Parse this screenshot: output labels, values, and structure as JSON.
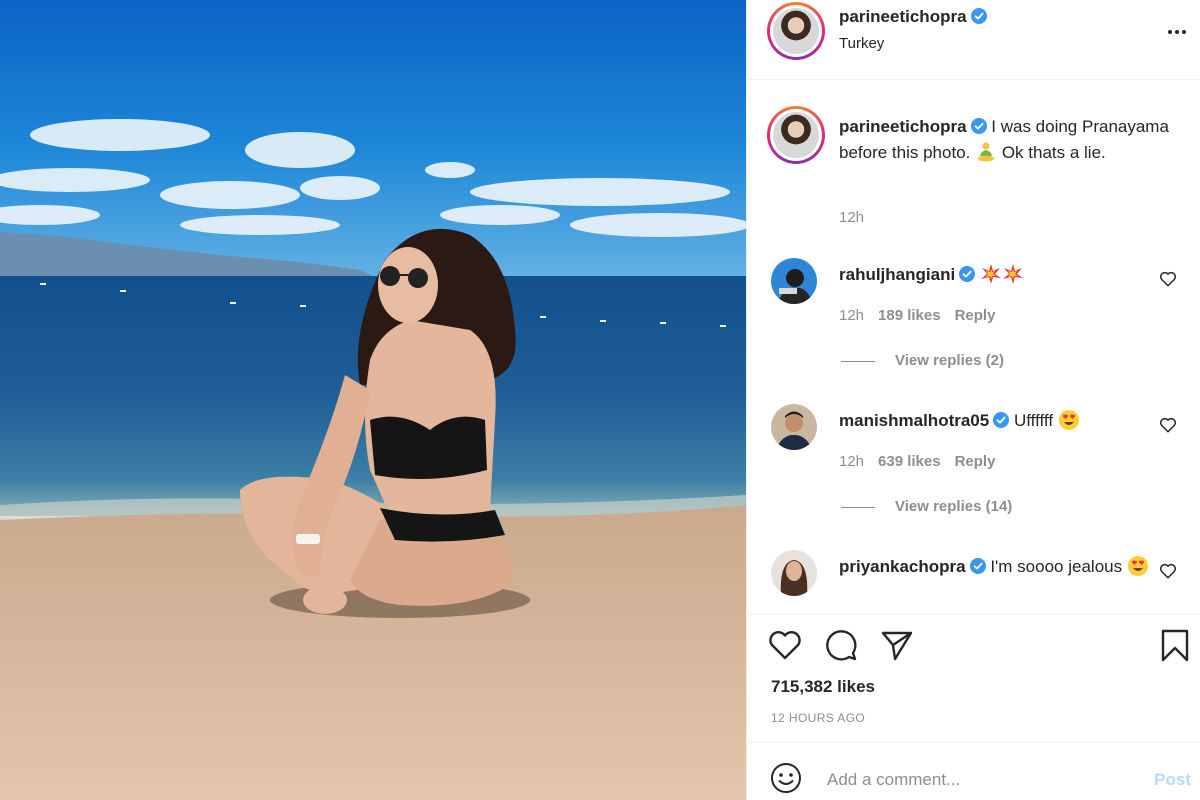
{
  "post": {
    "image_icon": "beach-photo",
    "colors": {
      "sky": "#1e88d8",
      "sea": "#1f5e97",
      "sand": "#d9b89a",
      "verified": "#3897f0",
      "post_disabled": "#b3dbff"
    }
  },
  "header": {
    "username": "parineetichopra",
    "location": "Turkey",
    "more_icon": "more-horizontal-icon"
  },
  "caption": {
    "username": "parineetichopra",
    "text_before": " I was doing Pranayama before this photo. ",
    "emoji": "lotus-position-emoji",
    "text_after": " Ok thats a lie.",
    "time": "12h"
  },
  "comments": [
    {
      "username": "rahuljhangiani",
      "text": "",
      "emojis": [
        "collision-emoji",
        "collision-emoji"
      ],
      "time": "12h",
      "likes": "189 likes",
      "reply": "Reply",
      "view_replies": "View replies (2)"
    },
    {
      "username": "manishmalhotra05",
      "text": " Uffffff ",
      "emojis": [
        "heart-eyes-emoji"
      ],
      "time": "12h",
      "likes": "639 likes",
      "reply": "Reply",
      "view_replies": "View replies (14)"
    },
    {
      "username": "priyankachopra",
      "text": " I'm soooo jealous ",
      "emojis": [
        "heart-eyes-emoji"
      ]
    }
  ],
  "actions": {
    "icons": [
      "heart-icon",
      "comment-icon",
      "share-icon",
      "bookmark-icon"
    ],
    "likes": "715,382 likes",
    "time_ago": "12 HOURS AGO"
  },
  "composer": {
    "placeholder": "Add a comment...",
    "post_label": "Post",
    "emoji_icon": "smiley-icon"
  }
}
